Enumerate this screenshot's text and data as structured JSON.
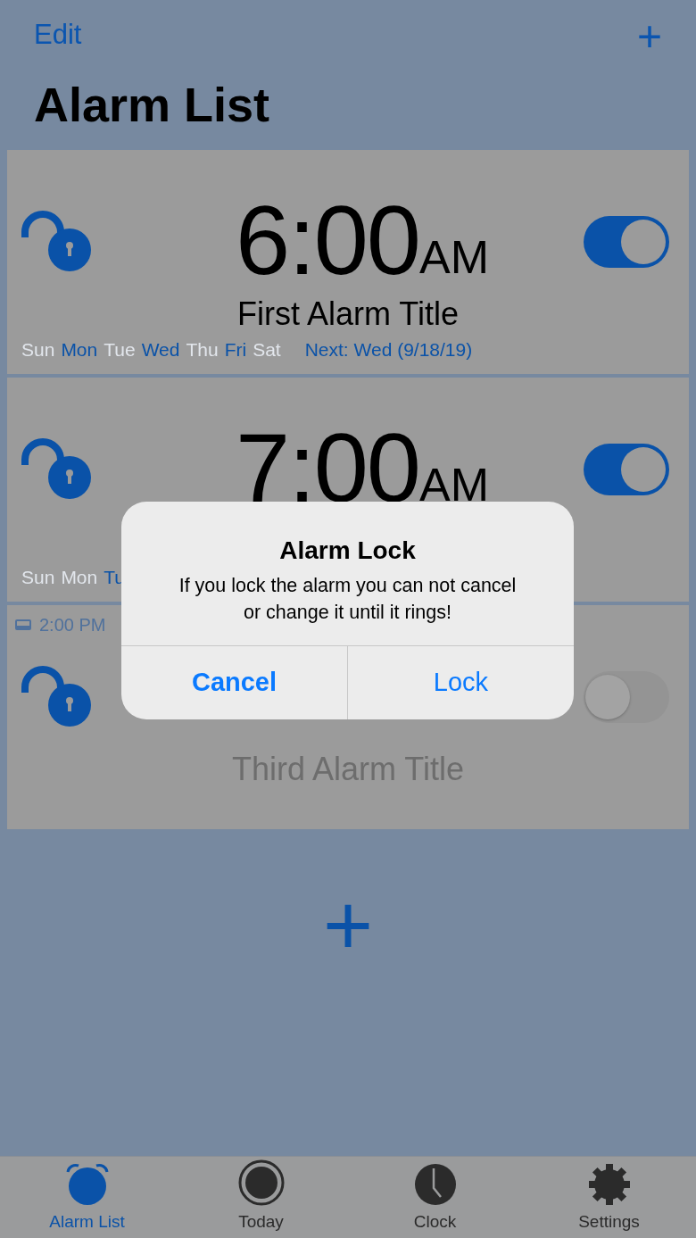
{
  "nav": {
    "edit": "Edit",
    "add": "+"
  },
  "title": "Alarm List",
  "alarms": [
    {
      "time": "6:00",
      "period": "AM",
      "title": "First Alarm Title",
      "on": true,
      "locked": false,
      "days": [
        {
          "label": "Sun",
          "on": false
        },
        {
          "label": "Mon",
          "on": true
        },
        {
          "label": "Tue",
          "on": false
        },
        {
          "label": "Wed",
          "on": true
        },
        {
          "label": "Thu",
          "on": false
        },
        {
          "label": "Fri",
          "on": true
        },
        {
          "label": "Sat",
          "on": false
        }
      ],
      "next": "Next: Wed (9/18/19)"
    },
    {
      "time": "7:00",
      "period": "AM",
      "on": true,
      "locked": false,
      "days": [
        {
          "label": "Sun",
          "on": false
        },
        {
          "label": "Mon",
          "on": false
        },
        {
          "label": "Tu",
          "on": true
        }
      ]
    },
    {
      "snooze": "2:00 PM",
      "title": "Third Alarm Title",
      "on": false,
      "locked": false
    }
  ],
  "add_alarm": "+",
  "dialog": {
    "title": "Alarm Lock",
    "message": "If you lock the alarm you can not cancel or change it until it rings!",
    "buttons": [
      {
        "label": "Cancel",
        "kind": "cancel"
      },
      {
        "label": "Lock",
        "kind": "default"
      }
    ]
  },
  "tabs": [
    {
      "label": "Alarm List",
      "kind": "alarm",
      "selected": true
    },
    {
      "label": "Today",
      "kind": "today",
      "selected": false
    },
    {
      "label": "Clock",
      "kind": "clock",
      "selected": false
    },
    {
      "label": "Settings",
      "kind": "settings",
      "selected": false
    }
  ]
}
